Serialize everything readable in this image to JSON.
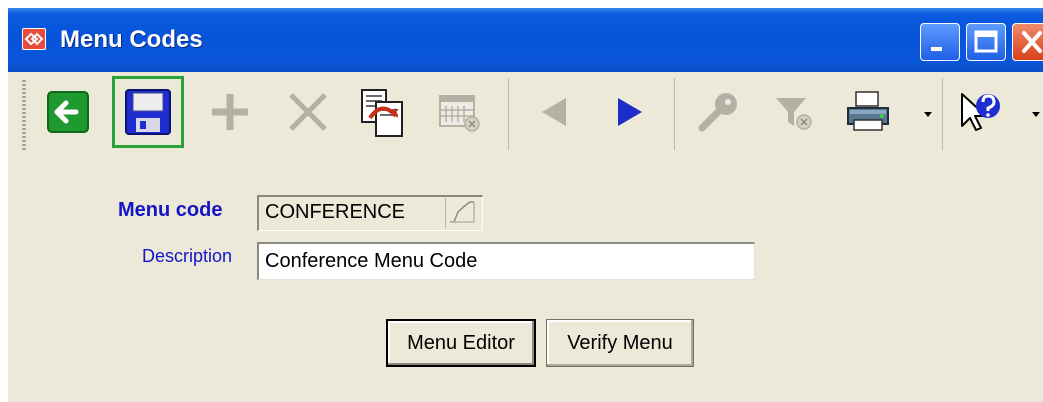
{
  "window": {
    "title": "Menu Codes",
    "controls": {
      "minimize_icon": "minimize-icon",
      "maximize_icon": "maximize-icon",
      "close_icon": "close-icon"
    }
  },
  "toolbar": {
    "buttons": [
      {
        "icon": "back-arrow-icon",
        "state": "enabled"
      },
      {
        "icon": "save-disk-icon",
        "state": "enabled",
        "highlighted": true
      },
      {
        "icon": "add-plus-icon",
        "state": "disabled"
      },
      {
        "icon": "delete-x-icon",
        "state": "disabled"
      },
      {
        "icon": "copy-refresh-icon",
        "state": "enabled"
      },
      {
        "icon": "calendar-grid-icon",
        "state": "disabled"
      },
      {
        "icon": "previous-arrow-icon",
        "state": "disabled"
      },
      {
        "icon": "next-arrow-icon",
        "state": "enabled"
      },
      {
        "icon": "search-key-icon",
        "state": "disabled"
      },
      {
        "icon": "filter-icon",
        "state": "disabled"
      },
      {
        "icon": "printer-icon",
        "state": "enabled",
        "dropdown": true
      },
      {
        "icon": "help-pointer-icon",
        "state": "enabled",
        "dropdown": true
      }
    ],
    "highlight_color": "#2aa33a"
  },
  "form": {
    "menu_code": {
      "label": "Menu code",
      "value": "CONFERENCE"
    },
    "description": {
      "label": "Description",
      "value": "Conference Menu Code"
    },
    "buttons": {
      "menu_editor": "Menu Editor",
      "verify_menu": "Verify Menu"
    }
  },
  "colors": {
    "titlebar": "#0553d8",
    "window_bg": "#ECE9D8",
    "label_blue": "#1414c8",
    "next_arrow": "#1c2ec8",
    "back_arrow_bg": "#1f9a2e",
    "disabled_icon": "#b4b1a4"
  }
}
